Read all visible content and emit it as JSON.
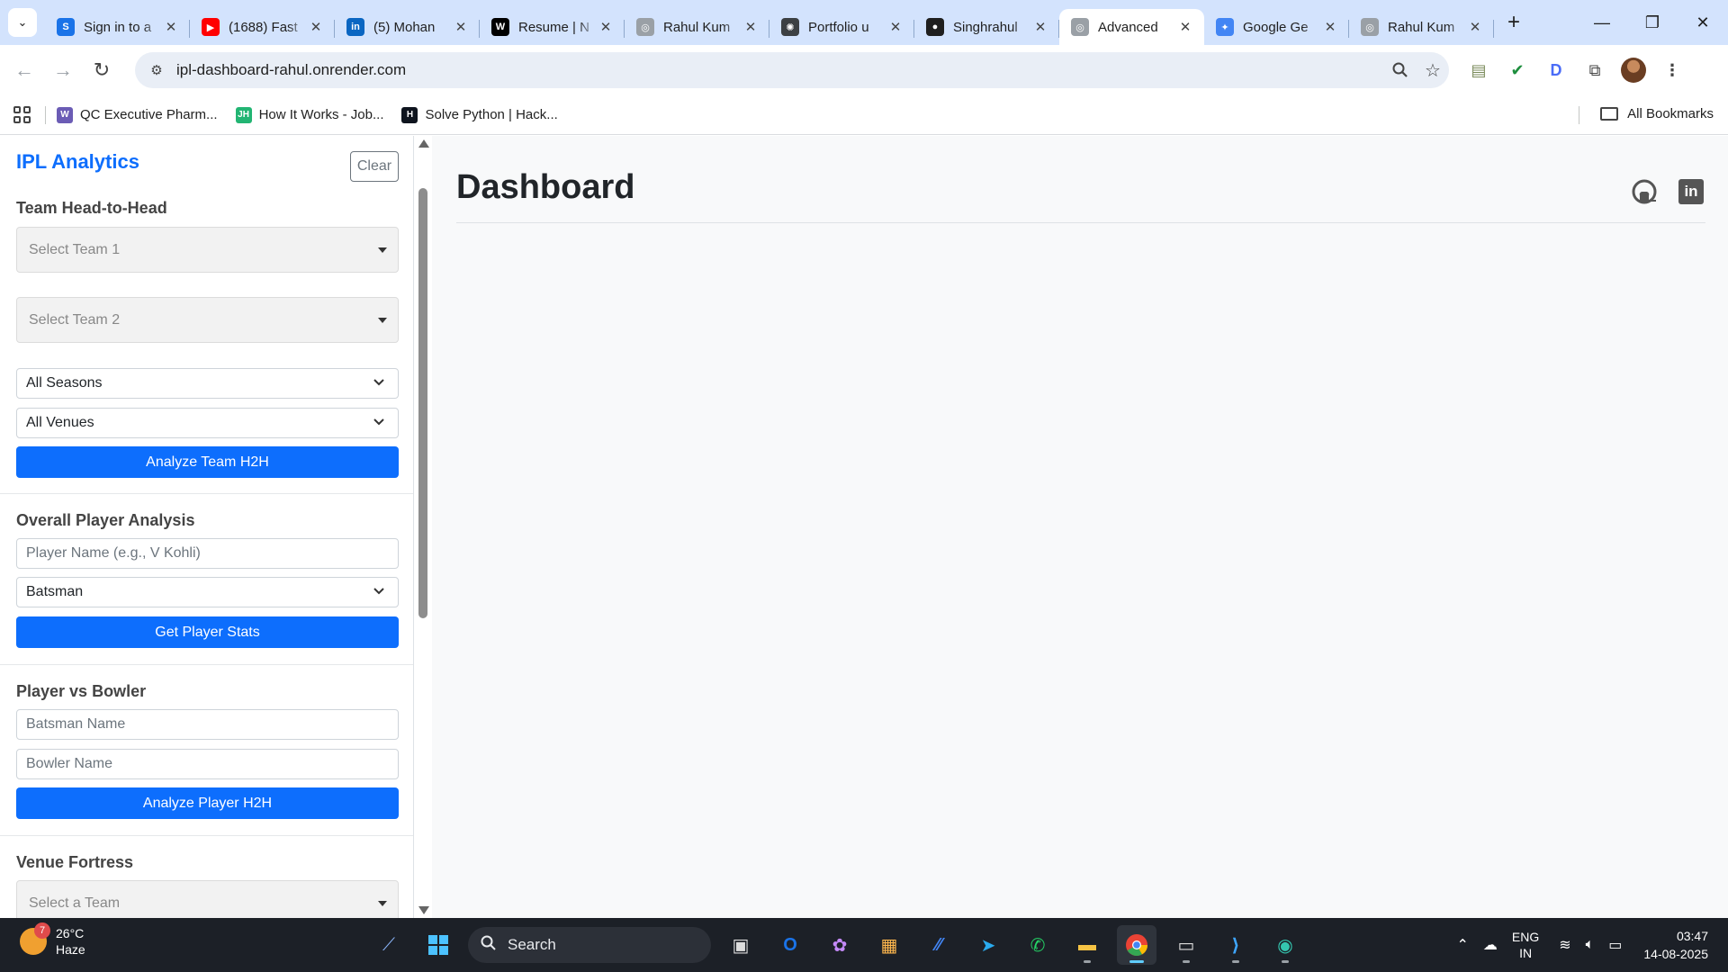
{
  "browser": {
    "tabs": [
      {
        "title": "Sign in to a",
        "favicon_color": "#1a73e8",
        "favicon_letter": "S",
        "active": false
      },
      {
        "title": "(1688) Fast",
        "favicon_color": "#ff0000",
        "favicon_letter": "▶",
        "active": false
      },
      {
        "title": "(5) Mohan",
        "favicon_color": "#0a66c2",
        "favicon_letter": "in",
        "active": false
      },
      {
        "title": "Resume | N",
        "favicon_color": "#000000",
        "favicon_letter": "W",
        "active": false
      },
      {
        "title": "Rahul Kum",
        "favicon_color": "#9aa0a6",
        "favicon_letter": "◎",
        "active": false
      },
      {
        "title": "Portfolio u",
        "favicon_color": "#3c4043",
        "favicon_letter": "✺",
        "active": false
      },
      {
        "title": "Singhrahul",
        "favicon_color": "#1f1f1f",
        "favicon_letter": "●",
        "active": false
      },
      {
        "title": "Advanced",
        "favicon_color": "#9aa0a6",
        "favicon_letter": "◎",
        "active": true
      },
      {
        "title": "Google Ge",
        "favicon_color": "#4285f4",
        "favicon_letter": "✦",
        "active": false
      },
      {
        "title": "Rahul Kum",
        "favicon_color": "#9aa0a6",
        "favicon_letter": "◎",
        "active": false
      }
    ],
    "url": "ipl-dashboard-rahul.onrender.com",
    "bookmarks": [
      {
        "label": "QC Executive Pharm...",
        "icon_color": "#6b5cb5",
        "icon_letter": "W"
      },
      {
        "label": "How It Works - Job...",
        "icon_color": "#22b573",
        "icon_letter": "JH"
      },
      {
        "label": "Solve Python | Hack...",
        "icon_color": "#0e141e",
        "icon_letter": "H"
      }
    ],
    "all_bookmarks_label": "All Bookmarks"
  },
  "sidebar": {
    "brand": "IPL Analytics",
    "clear_label": "Clear",
    "team_h2h": {
      "title": "Team Head-to-Head",
      "team1_placeholder": "Select Team 1",
      "team2_placeholder": "Select Team 2",
      "season_value": "All Seasons",
      "venue_value": "All Venues",
      "button": "Analyze Team H2H"
    },
    "player_analysis": {
      "title": "Overall Player Analysis",
      "name_placeholder": "Player Name (e.g., V Kohli)",
      "role_value": "Batsman",
      "button": "Get Player Stats"
    },
    "player_vs_bowler": {
      "title": "Player vs Bowler",
      "batsman_placeholder": "Batsman Name",
      "bowler_placeholder": "Bowler Name",
      "button": "Analyze Player H2H"
    },
    "venue_fortress": {
      "title": "Venue Fortress",
      "team_placeholder": "Select a Team"
    }
  },
  "main": {
    "title": "Dashboard",
    "social_icons": [
      "github-icon",
      "linkedin-icon"
    ]
  },
  "taskbar": {
    "weather_temp": "26°C",
    "weather_desc": "Haze",
    "weather_badge": "7",
    "search_label": "Search",
    "lang_line1": "ENG",
    "lang_line2": "IN",
    "time": "03:47",
    "date": "14-08-2025"
  },
  "colors": {
    "accent": "#0d6efd",
    "tabstrip": "#d3e3fd",
    "taskbar": "#1c2027"
  }
}
